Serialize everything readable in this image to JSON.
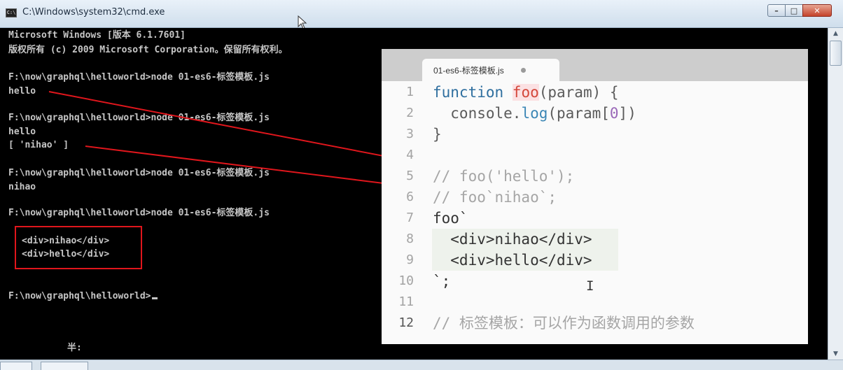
{
  "window": {
    "title": "C:\\Windows\\system32\\cmd.exe",
    "icon_text": "C:\\",
    "buttons": {
      "minimize": "–",
      "maximize": "□",
      "close": "✕"
    }
  },
  "console": {
    "lines": [
      "Microsoft Windows [版本 6.1.7601]",
      "版权所有 (c) 2009 Microsoft Corporation。保留所有权利。",
      "F:\\now\\graphql\\helloworld>node 01-es6-标签模板.js",
      "hello",
      "F:\\now\\graphql\\helloworld>node 01-es6-标签模板.js",
      "hello",
      "[ 'nihao' ]",
      "F:\\now\\graphql\\helloworld>node 01-es6-标签模板.js",
      "nihao",
      "F:\\now\\graphql\\helloworld>node 01-es6-标签模板.js",
      "<div>nihao</div>",
      "<div>hello</div>",
      "F:\\now\\graphql\\helloworld>",
      "半:"
    ]
  },
  "editor": {
    "tab_title": "01-es6-标签模板.js",
    "code_lines": [
      {
        "num": "1",
        "tokens": [
          [
            "k-blue",
            "function "
          ],
          [
            "k-fn",
            "foo"
          ],
          [
            "k-plain",
            "(param) {"
          ]
        ]
      },
      {
        "num": "2",
        "tokens": [
          [
            "k-plain",
            "  console."
          ],
          [
            "k-call",
            "log"
          ],
          [
            "k-plain",
            "(param["
          ],
          [
            "k-purple",
            "0"
          ],
          [
            "k-plain",
            "])"
          ]
        ]
      },
      {
        "num": "3",
        "tokens": [
          [
            "k-plain",
            "}"
          ]
        ]
      },
      {
        "num": "4",
        "tokens": []
      },
      {
        "num": "5",
        "tokens": [
          [
            "k-comment",
            "// foo('hello');"
          ]
        ]
      },
      {
        "num": "6",
        "tokens": [
          [
            "k-comment",
            "// foo`nihao`;"
          ]
        ]
      },
      {
        "num": "7",
        "tokens": [
          [
            "k-dk",
            "foo`"
          ]
        ]
      },
      {
        "num": "8",
        "tokens": [
          [
            "k-dk",
            "  <div>nihao</div>"
          ]
        ]
      },
      {
        "num": "9",
        "tokens": [
          [
            "k-dk",
            "  <div>hello</div>"
          ]
        ]
      },
      {
        "num": "10",
        "tokens": [
          [
            "k-dk",
            "`;"
          ]
        ]
      },
      {
        "num": "11",
        "tokens": []
      },
      {
        "num": "12",
        "tokens": [
          [
            "k-comment",
            "// 标签模板：可以作为函数调用的参数"
          ]
        ]
      }
    ]
  },
  "colors": {
    "annotation_red": "#e0161c",
    "console_bg": "#000000",
    "console_fg": "#c6c6c6"
  }
}
